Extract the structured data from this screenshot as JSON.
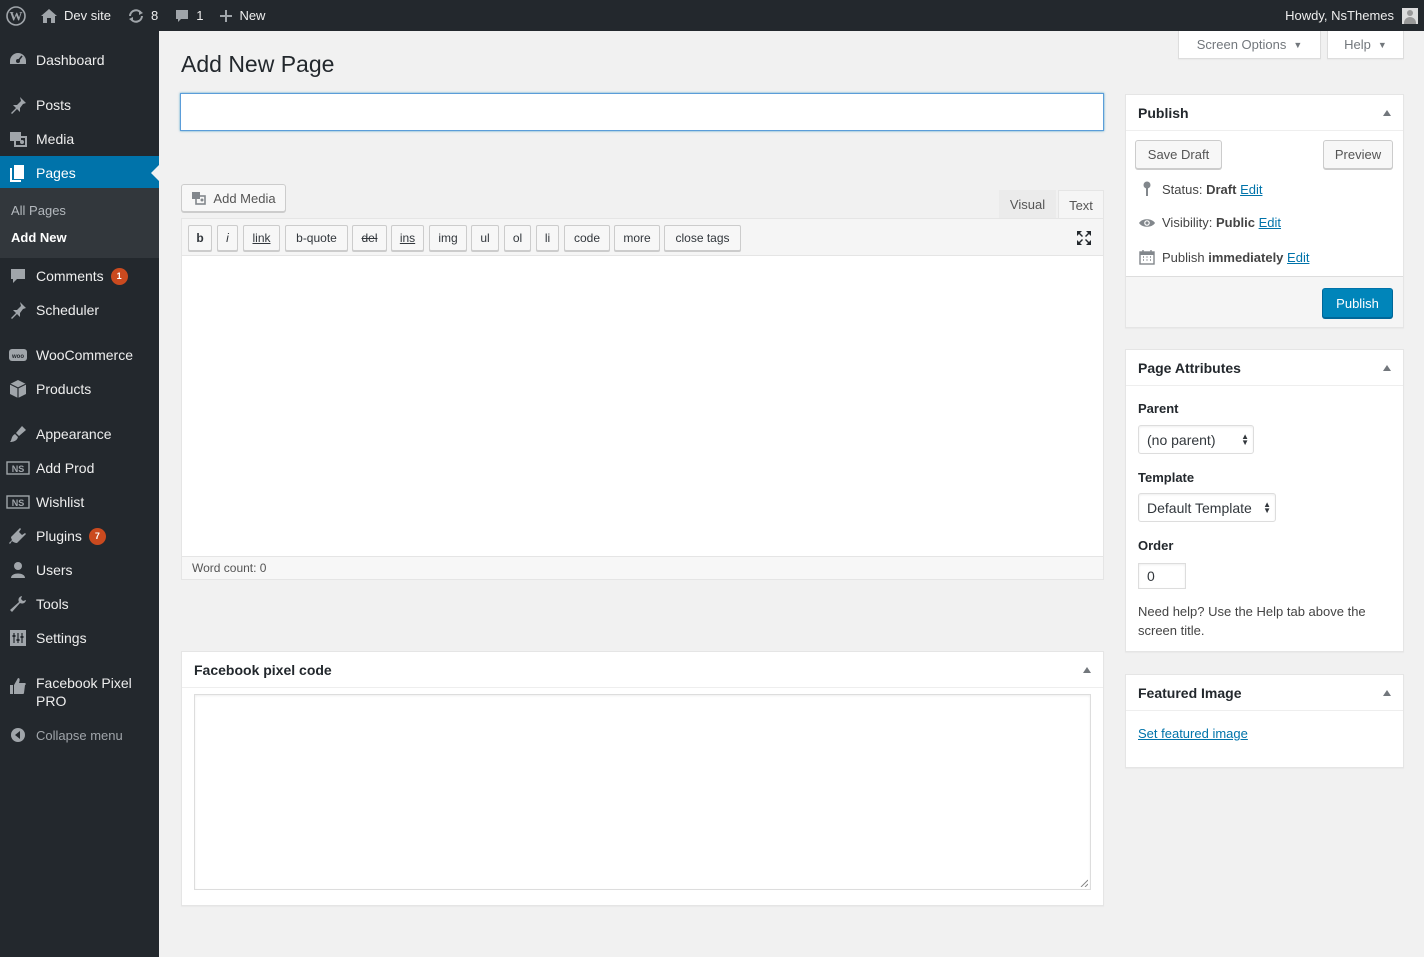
{
  "admin_bar": {
    "site_name": "Dev site",
    "updates_count": "8",
    "comments_count": "1",
    "new_label": "New",
    "greeting": "Howdy, NsThemes"
  },
  "menu": {
    "items": [
      {
        "label": "Dashboard",
        "icon": "dashboard-icon"
      },
      {
        "label": "Posts",
        "icon": "pin-icon"
      },
      {
        "label": "Media",
        "icon": "media-icon"
      },
      {
        "label": "Pages",
        "icon": "page-icon"
      },
      {
        "label": "Comments",
        "icon": "comment-icon",
        "badge": "1"
      },
      {
        "label": "Scheduler",
        "icon": "pin-icon"
      },
      {
        "label": "WooCommerce",
        "icon": "woo-icon"
      },
      {
        "label": "Products",
        "icon": "box-icon"
      },
      {
        "label": "Appearance",
        "icon": "brush-icon"
      },
      {
        "label": "Add Prod",
        "icon": "ns-icon"
      },
      {
        "label": "Wishlist",
        "icon": "ns-icon"
      },
      {
        "label": "Plugins",
        "icon": "plug-icon",
        "badge": "7"
      },
      {
        "label": "Users",
        "icon": "user-icon"
      },
      {
        "label": "Tools",
        "icon": "wrench-icon"
      },
      {
        "label": "Settings",
        "icon": "settings-icon"
      },
      {
        "label": "Facebook Pixel PRO",
        "icon": "thumbs-up-icon"
      }
    ],
    "submenu": [
      "All Pages",
      "Add New"
    ],
    "collapse_label": "Collapse menu"
  },
  "screen_meta": {
    "screen_options": "Screen Options",
    "help": "Help"
  },
  "page": {
    "title": "Add New Page",
    "title_input_value": ""
  },
  "editor": {
    "add_media": "Add Media",
    "tab_visual": "Visual",
    "tab_text": "Text",
    "quicktags": [
      "b",
      "i",
      "link",
      "b-quote",
      "del",
      "ins",
      "img",
      "ul",
      "ol",
      "li",
      "code",
      "more",
      "close tags"
    ],
    "word_count": "Word count: 0"
  },
  "publish_box": {
    "title": "Publish",
    "save_draft": "Save Draft",
    "preview": "Preview",
    "status_label": "Status:",
    "status_value": "Draft",
    "visibility_label": "Visibility:",
    "visibility_value": "Public",
    "publish_label": "Publish",
    "publish_value": "immediately",
    "edit": "Edit",
    "publish_button": "Publish"
  },
  "page_attributes": {
    "title": "Page Attributes",
    "parent_label": "Parent",
    "parent_value": "(no parent)",
    "template_label": "Template",
    "template_value": "Default Template",
    "order_label": "Order",
    "order_value": "0",
    "help_text": "Need help? Use the Help tab above the screen title."
  },
  "featured_image": {
    "title": "Featured Image",
    "link": "Set featured image"
  },
  "facebook_box": {
    "title": "Facebook pixel code"
  },
  "colors": {
    "admin_dark": "#23282d",
    "accent": "#0073aa",
    "badge": "#ca4a1f",
    "background": "#f1f1f1"
  }
}
